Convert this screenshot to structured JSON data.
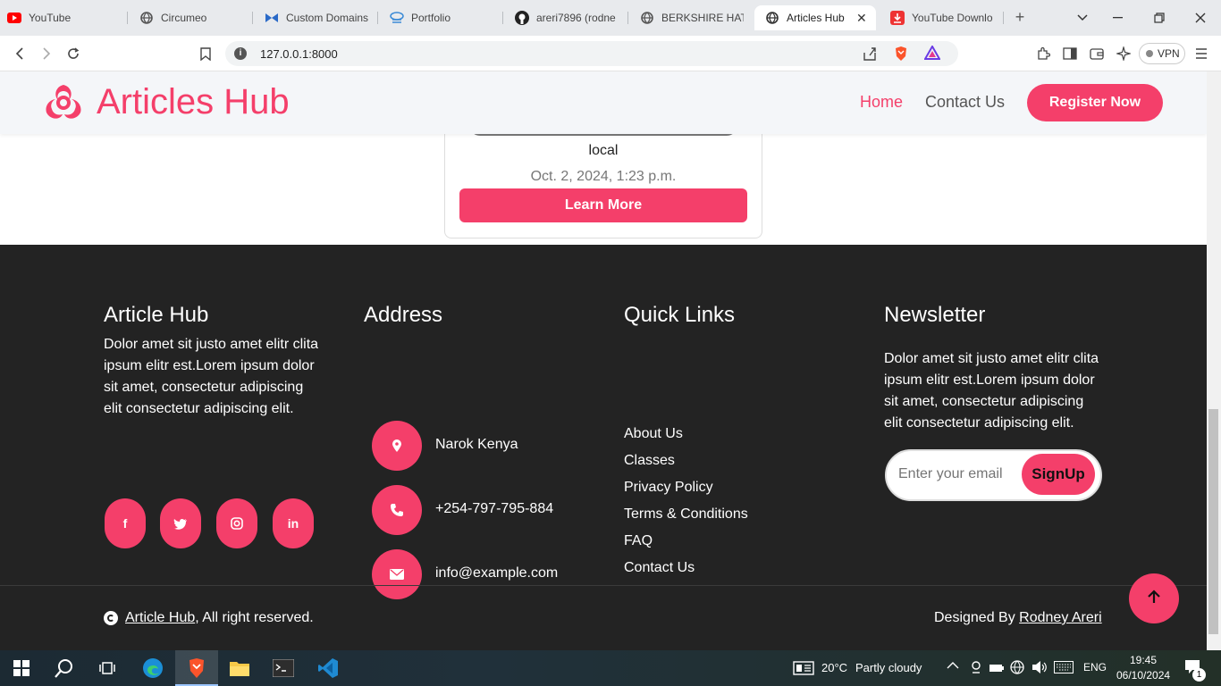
{
  "browser": {
    "tabs": [
      {
        "label": "YouTube",
        "icon": "youtube-icon"
      },
      {
        "label": "Circumeo",
        "icon": "globe-icon"
      },
      {
        "label": "Custom Domains",
        "icon": "custom-domains-icon"
      },
      {
        "label": "Portfolio",
        "icon": "portfolio-icon"
      },
      {
        "label": "areri7896 (rodne",
        "icon": "github-icon"
      },
      {
        "label": "BERKSHIRE HATH",
        "icon": "globe-icon"
      },
      {
        "label": "Articles Hub",
        "icon": "globe-icon"
      },
      {
        "label": "YouTube Downlo",
        "icon": "download-icon"
      }
    ],
    "url": "127.0.0.1:8000",
    "vpn_label": "VPN"
  },
  "nav": {
    "brand": "Articles Hub",
    "home": "Home",
    "contact": "Contact Us",
    "register": "Register Now"
  },
  "card": {
    "author": "local",
    "date": "Oct. 2, 2024, 1:23 p.m.",
    "learn_more": "Learn More"
  },
  "footer": {
    "about": {
      "title": "Article Hub",
      "text_lines": [
        "Dolor amet sit justo amet elitr clita",
        "ipsum elitr est.Lorem ipsum dolor",
        "sit amet, consectetur adipiscing",
        "elit consectetur adipiscing elit."
      ]
    },
    "address": {
      "title": "Address",
      "location": "Narok Kenya",
      "phone": "+254-797-795-884",
      "email": "info@example.com"
    },
    "quick_links": {
      "title": "Quick Links",
      "items": [
        "About Us",
        "Classes",
        "Privacy Policy",
        "Terms & Conditions",
        "FAQ",
        "Contact Us"
      ]
    },
    "newsletter": {
      "title": "Newsletter",
      "text_lines": [
        "Dolor amet sit justo amet elitr clita",
        "ipsum elitr est.Lorem ipsum dolor",
        "sit amet, consectetur adipiscing",
        "elit consectetur adipiscing elit."
      ],
      "placeholder": "Enter your email",
      "button": "SignUp"
    },
    "copyright_link": "Article Hub",
    "copyright_rest": ", All right reserved.",
    "designed_by": "Designed By ",
    "designer": "Rodney Areri"
  },
  "taskbar": {
    "weather_temp": "20°C",
    "weather_desc": "Partly cloudy",
    "lang": "ENG",
    "time": "19:45",
    "date": "06/10/2024",
    "notifications": "1"
  },
  "colors": {
    "accent": "#f43f6a",
    "footer_bg": "#232323",
    "nav_bg": "#f4f6f9"
  }
}
